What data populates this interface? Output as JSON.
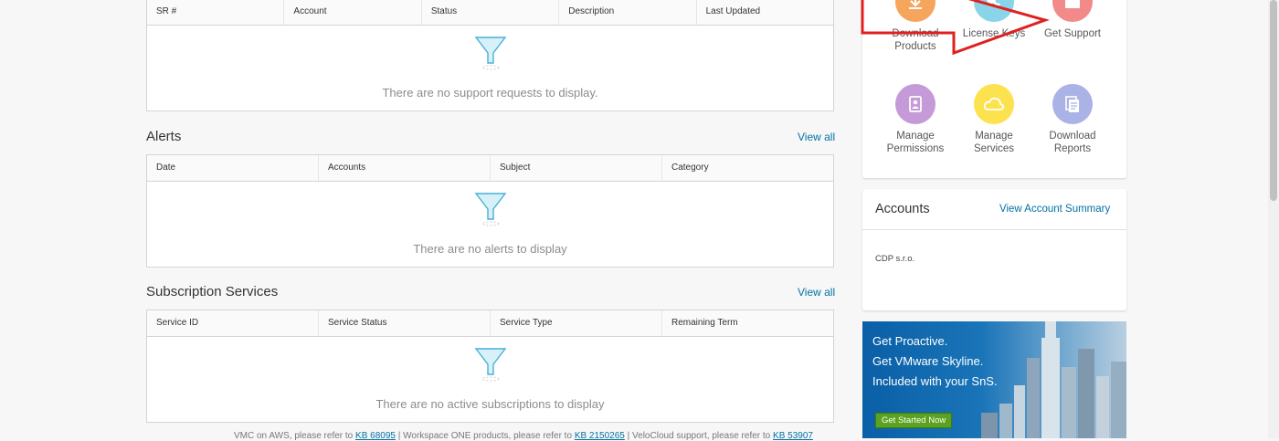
{
  "support": {
    "columns": [
      "SR #",
      "Account",
      "Status",
      "Description",
      "Last Updated"
    ],
    "empty": "There are no support requests to display."
  },
  "alerts": {
    "title": "Alerts",
    "view_all": "View all",
    "columns": [
      "Date",
      "Accounts",
      "Subject",
      "Category"
    ],
    "empty": "There are no alerts to display"
  },
  "subs": {
    "title": "Subscription Services",
    "view_all": "View all",
    "columns": [
      "Service ID",
      "Service Status",
      "Service Type",
      "Remaining Term"
    ],
    "empty": "There are no active subscriptions to display"
  },
  "footer": {
    "t1": "VMC on AWS, please refer to",
    "l1": "KB 68095",
    "t2": "| Workspace ONE products, please refer to",
    "l2": "KB 2150265",
    "t3": "| VeloCloud support, please refer to",
    "l3": "KB 53907"
  },
  "quick": {
    "download_products": "Download Products",
    "license_keys": "License Keys",
    "get_support": "Get Support",
    "manage_permissions": "Manage Permissions",
    "manage_services": "Manage Services",
    "download_reports": "Download Reports",
    "colors": {
      "download": "#f5a55c",
      "license": "#8ad4ea",
      "support": "#f28a8a",
      "permissions": "#c59ad8",
      "services": "#fde24f",
      "reports": "#aab2e6"
    }
  },
  "accounts": {
    "title": "Accounts",
    "link": "View Account Summary",
    "item": "CDP s.r.o."
  },
  "banner": {
    "line1": "Get Proactive.",
    "line2": "Get VMware Skyline.",
    "line3": "Included with your SnS.",
    "cta": "Get Started Now"
  },
  "annotation_color": "#e02020"
}
